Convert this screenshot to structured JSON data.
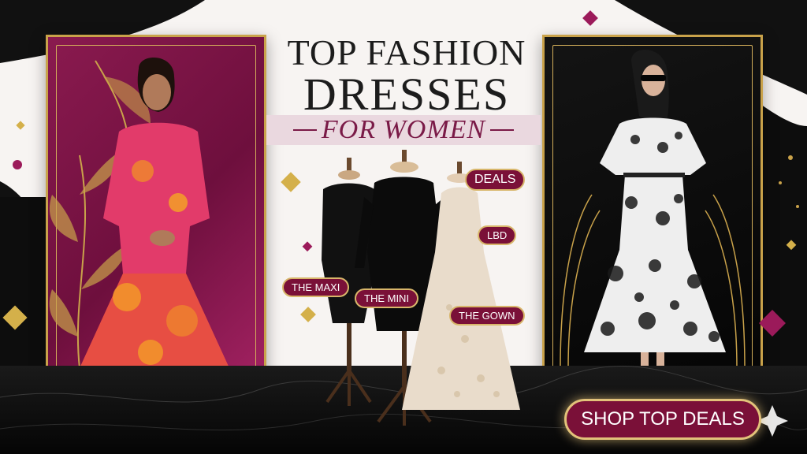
{
  "banner": {
    "title_line1": "TOP FASHION",
    "title_line2": "DRESSES",
    "subtitle": "FOR WOMEN"
  },
  "labels": {
    "deals": "DEALS",
    "lbd": "LBD",
    "maxi": "THE MAXI",
    "mini": "THE MINI",
    "gown": "THE GOWN"
  },
  "cta": {
    "label": "SHOP TOP DEALS"
  },
  "colors": {
    "accent_plum": "#7a1038",
    "gold": "#c9a24a",
    "magenta_panel": "#8a1a4f",
    "black_panel": "#0a0a0a"
  }
}
